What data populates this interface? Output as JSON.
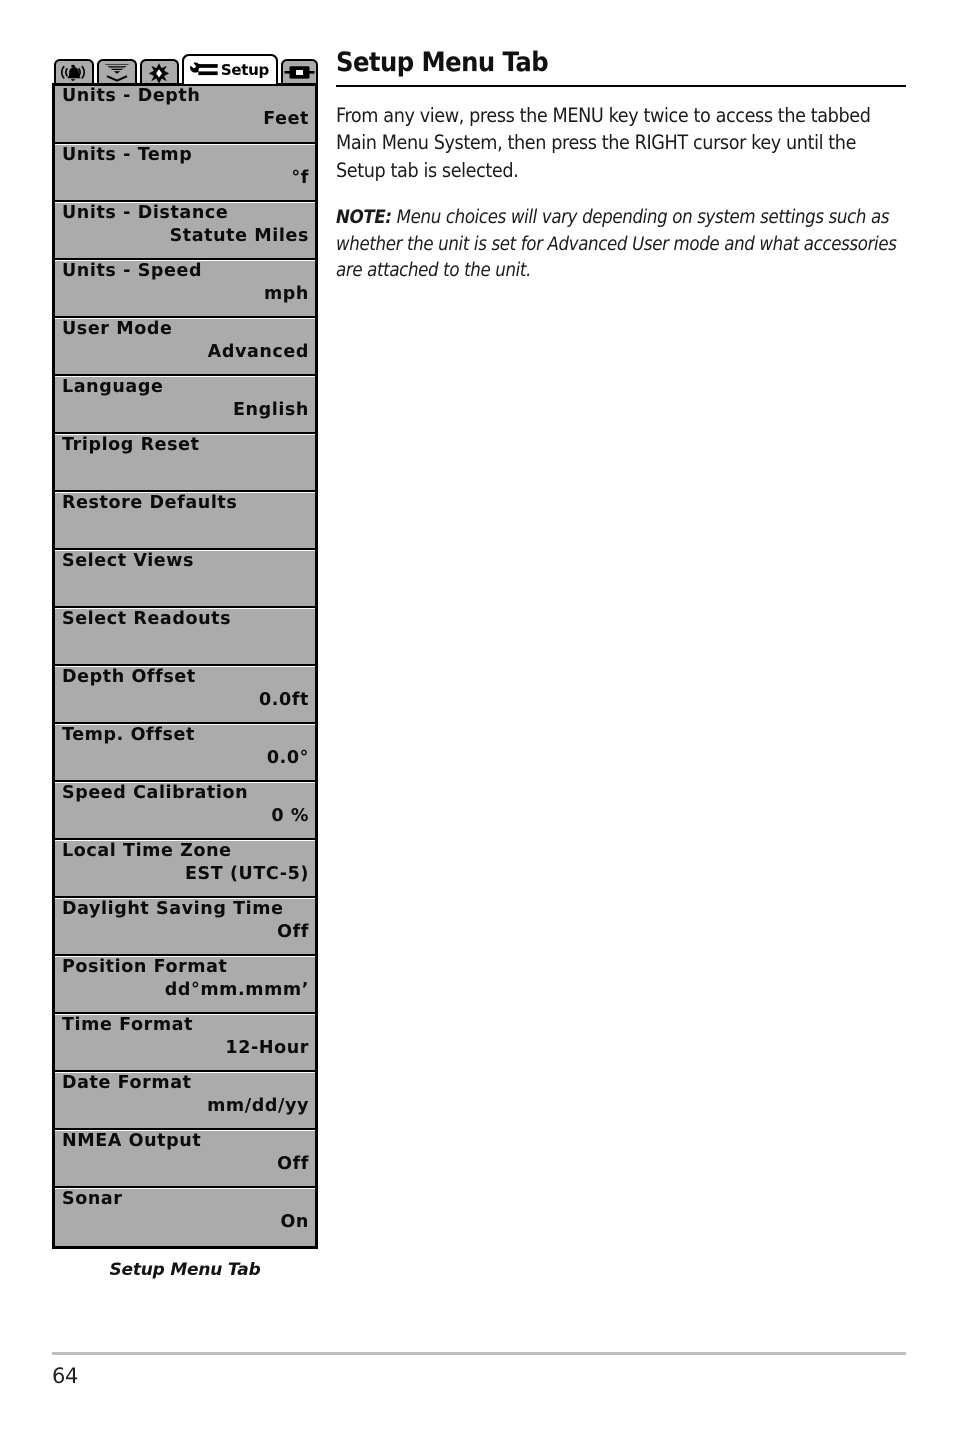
{
  "page": {
    "heading": "Setup Menu Tab",
    "number": "64"
  },
  "content": {
    "intro": "From any view, press the MENU key twice to access the tabbed Main Menu System, then press the RIGHT cursor key until the Setup tab is selected.",
    "note_label": "NOTE:",
    "note_text": " Menu choices will vary depending on system settings such as whether the unit is set for Advanced User mode and what accessories are attached to the unit."
  },
  "figure": {
    "caption": "Setup Menu Tab",
    "lcd_background": "#ababab",
    "active_tab_background": "#ffffff",
    "tabs": [
      {
        "name": "alarm-tab",
        "icon": "alarm-bell-icon",
        "label": "",
        "active": false
      },
      {
        "name": "sonar-tab",
        "icon": "sonar-beam-icon",
        "label": "",
        "active": false
      },
      {
        "name": "display-tab",
        "icon": "brightness-sun-icon",
        "label": "",
        "active": false
      },
      {
        "name": "setup-tab",
        "icon": "wrench-icon",
        "label": "Setup",
        "active": true
      },
      {
        "name": "views-tab",
        "icon": "screen-icon",
        "label": "",
        "active": false
      }
    ],
    "menu_items": [
      {
        "label": "Units - Depth",
        "value": "Feet"
      },
      {
        "label": "Units - Temp",
        "value": "°f"
      },
      {
        "label": "Units - Distance",
        "value": "Statute Miles"
      },
      {
        "label": "Units - Speed",
        "value": "mph"
      },
      {
        "label": "User Mode",
        "value": "Advanced"
      },
      {
        "label": "Language",
        "value": "English"
      },
      {
        "label": "Triplog Reset",
        "value": ""
      },
      {
        "label": "Restore Defaults",
        "value": ""
      },
      {
        "label": "Select Views",
        "value": ""
      },
      {
        "label": "Select Readouts",
        "value": ""
      },
      {
        "label": "Depth Offset",
        "value": "0.0ft"
      },
      {
        "label": "Temp. Offset",
        "value": "0.0°"
      },
      {
        "label": "Speed Calibration",
        "value": "0 %"
      },
      {
        "label": "Local Time Zone",
        "value": "EST (UTC-5)"
      },
      {
        "label": "Daylight Saving Time",
        "value": "Off"
      },
      {
        "label": "Position Format",
        "value": "dd°mm.mmm’"
      },
      {
        "label": "Time Format",
        "value": "12-Hour"
      },
      {
        "label": "Date Format",
        "value": "mm/dd/yy"
      },
      {
        "label": "NMEA Output",
        "value": "Off"
      },
      {
        "label": "Sonar",
        "value": "On"
      }
    ]
  }
}
